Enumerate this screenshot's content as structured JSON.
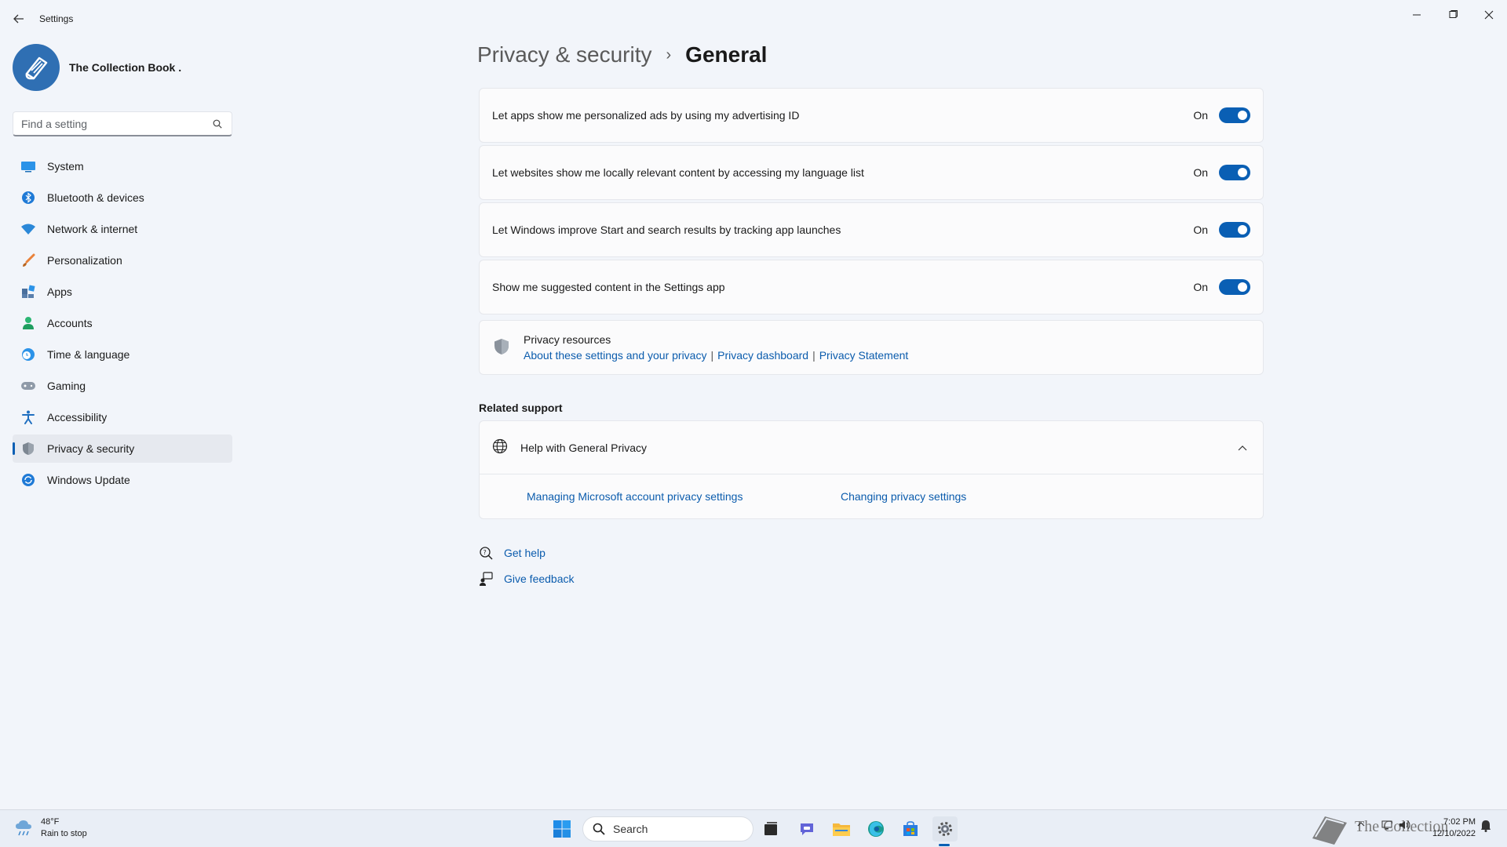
{
  "window": {
    "title": "Settings",
    "back_icon": "back-arrow-icon",
    "controls": [
      "minimize-icon",
      "maximize-icon",
      "close-icon"
    ]
  },
  "profile": {
    "name": "The Collection Book ."
  },
  "search": {
    "placeholder": "Find a setting"
  },
  "sidebar": {
    "items": [
      {
        "label": "System",
        "icon": "system-icon",
        "active": false
      },
      {
        "label": "Bluetooth & devices",
        "icon": "bluetooth-icon",
        "active": false
      },
      {
        "label": "Network & internet",
        "icon": "wifi-icon",
        "active": false
      },
      {
        "label": "Personalization",
        "icon": "brush-icon",
        "active": false
      },
      {
        "label": "Apps",
        "icon": "apps-icon",
        "active": false
      },
      {
        "label": "Accounts",
        "icon": "person-icon",
        "active": false
      },
      {
        "label": "Time & language",
        "icon": "clock-globe-icon",
        "active": false
      },
      {
        "label": "Gaming",
        "icon": "controller-icon",
        "active": false
      },
      {
        "label": "Accessibility",
        "icon": "accessibility-icon",
        "active": false
      },
      {
        "label": "Privacy & security",
        "icon": "shield-icon",
        "active": true
      },
      {
        "label": "Windows Update",
        "icon": "update-icon",
        "active": false
      }
    ]
  },
  "header": {
    "parent": "Privacy & security",
    "separator": "›",
    "current": "General"
  },
  "settings": [
    {
      "label": "Let apps show me personalized ads by using my advertising ID",
      "state": "On",
      "checked": true
    },
    {
      "label": "Let websites show me locally relevant content by accessing my language list",
      "state": "On",
      "checked": true
    },
    {
      "label": "Let Windows improve Start and search results by tracking app launches",
      "state": "On",
      "checked": true
    },
    {
      "label": "Show me suggested content in the Settings app",
      "state": "On",
      "checked": true
    }
  ],
  "privacy_resources": {
    "title": "Privacy resources",
    "links": [
      "About these settings and your privacy",
      "Privacy dashboard",
      "Privacy Statement"
    ],
    "separator": "|"
  },
  "related_support": {
    "title": "Related support",
    "help_title": "Help with General Privacy",
    "links": [
      "Managing Microsoft account privacy settings",
      "Changing privacy settings"
    ]
  },
  "footer": {
    "get_help": "Get help",
    "give_feedback": "Give feedback"
  },
  "taskbar": {
    "weather_temp": "48°F",
    "weather_desc": "Rain to stop",
    "search_label": "Search",
    "time": "7:02 PM",
    "date": "12/10/2022",
    "watermark": "The Collection Book",
    "apps": [
      "windows-start-icon",
      "task-view-icon",
      "teams-chat-icon",
      "file-explorer-icon",
      "edge-icon",
      "store-icon",
      "settings-icon"
    ]
  },
  "colors": {
    "accent": "#0a5fb4",
    "link": "#0b5cad",
    "background": "#f2f5fa"
  }
}
